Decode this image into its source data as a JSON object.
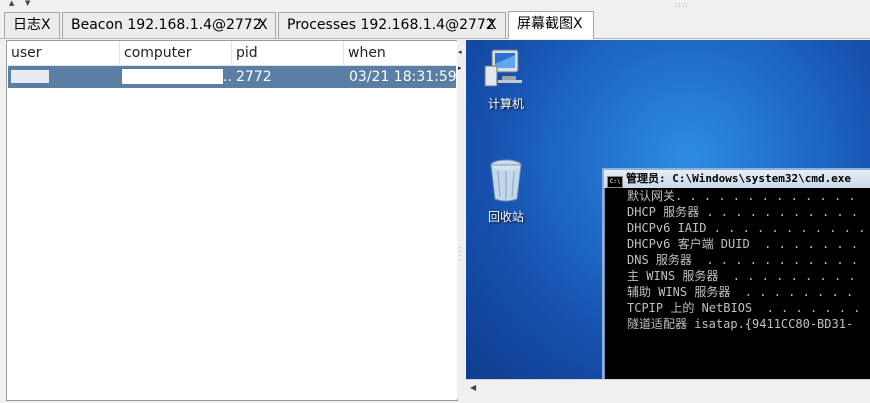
{
  "tabs": [
    {
      "label": "日志",
      "close": "X"
    },
    {
      "label": "Beacon 192.168.1.4@2772",
      "close": "X"
    },
    {
      "label": "Processes 192.168.1.4@2772",
      "close": "X"
    },
    {
      "label": "屏幕截图",
      "close": "X",
      "active": true
    }
  ],
  "table": {
    "columns": [
      "user",
      "computer",
      "pid",
      "when"
    ],
    "rows": [
      {
        "user": "",
        "computer": "..",
        "pid": "2772",
        "when": "03/21 18:31:59"
      }
    ]
  },
  "desktop": {
    "icons": [
      {
        "label": "计算机",
        "icon": "computer-icon"
      },
      {
        "label": "回收站",
        "icon": "recycle-bin-icon"
      }
    ],
    "cmd_window": {
      "title": "管理员: C:\\Windows\\system32\\cmd.exe",
      "lines": [
        "默认网关. . . . . . . . . . . . .",
        "DHCP 服务器 . . . . . . . . . . .",
        "DHCPv6 IAID . . . . . . . . . . .",
        "DHCPv6 客户端 DUID  . . . . . . .",
        "",
        "DNS 服务器  . . . . . . . . . . .",
        "",
        "主 WINS 服务器  . . . . . . . . .",
        "辅助 WINS 服务器  . . . . . . . .",
        "TCPIP 上的 NetBIOS  . . . . . . .",
        "",
        "隧道适配器 isatap.{9411CC80-BD31-"
      ]
    }
  },
  "colors": {
    "selected_row": "#5a7ea4",
    "desktop_blue": "#1f6dc9"
  }
}
